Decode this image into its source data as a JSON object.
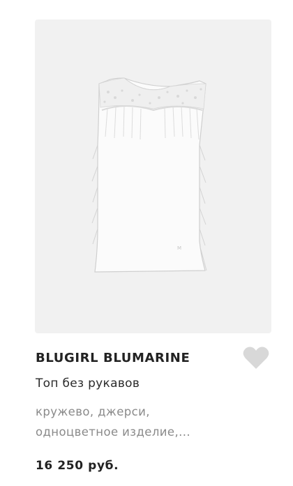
{
  "product": {
    "brand": "BLUGIRL BLUMARINE",
    "title": "Топ без рукавов",
    "description_line1": "кружево, джерси,",
    "description_line2": "одноцветное изделие,...",
    "price": "16 250 руб.",
    "image_icon": "sleeveless-lace-top-photo",
    "favorite_icon": "heart-icon",
    "favorite_color": "#d8d8d8"
  }
}
